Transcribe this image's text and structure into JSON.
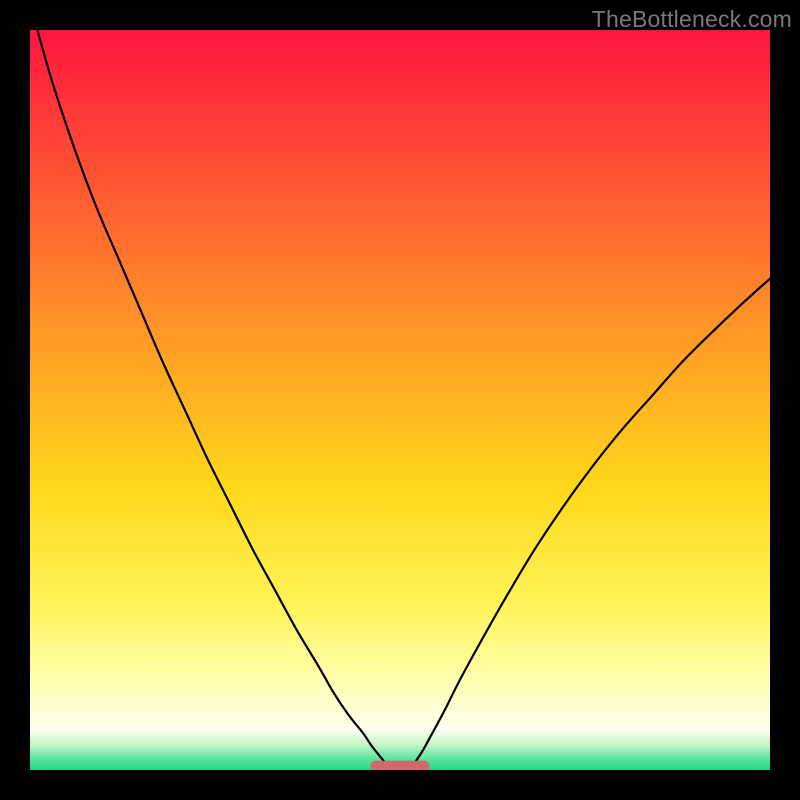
{
  "watermark": "TheBottleneck.com",
  "chart_data": {
    "type": "line",
    "title": "",
    "xlabel": "",
    "ylabel": "",
    "xlim": [
      0,
      100
    ],
    "ylim": [
      0,
      100
    ],
    "grid": false,
    "legend": false,
    "background_gradient": {
      "stops": [
        {
          "pos": 0.0,
          "color": "#ff163f"
        },
        {
          "pos": 0.12,
          "color": "#ff3b37"
        },
        {
          "pos": 0.28,
          "color": "#ff6d2f"
        },
        {
          "pos": 0.45,
          "color": "#ffa524"
        },
        {
          "pos": 0.62,
          "color": "#ffd81a"
        },
        {
          "pos": 0.78,
          "color": "#fff45b"
        },
        {
          "pos": 0.88,
          "color": "#ffffb0"
        },
        {
          "pos": 0.945,
          "color": "#fefef0"
        },
        {
          "pos": 0.965,
          "color": "#c8f7c8"
        },
        {
          "pos": 0.985,
          "color": "#5be29e"
        },
        {
          "pos": 1.0,
          "color": "#1fd882"
        }
      ]
    },
    "series": [
      {
        "name": "left-curve",
        "stroke": "#000000",
        "x": [
          1,
          3,
          6,
          9,
          12,
          15,
          18,
          21,
          24,
          27,
          30,
          33,
          36,
          39,
          41,
          43,
          45,
          46,
          47,
          48
        ],
        "y": [
          100,
          93,
          84,
          76,
          69,
          62,
          55,
          48.5,
          42,
          36,
          30,
          24.5,
          19,
          14,
          10.5,
          7.5,
          5,
          3.5,
          2.2,
          1
        ]
      },
      {
        "name": "right-curve",
        "stroke": "#000000",
        "x": [
          52,
          53,
          54,
          56,
          58,
          61,
          64,
          68,
          72,
          76,
          80,
          84,
          88,
          92,
          96,
          100
        ],
        "y": [
          1,
          2.5,
          4.3,
          8,
          12,
          17.5,
          22.8,
          29.5,
          35.5,
          41,
          46,
          50.5,
          55,
          59,
          62.8,
          66.4
        ]
      }
    ],
    "marker": {
      "name": "bottom-bar",
      "shape": "rounded-rect",
      "color": "#cf6a6a",
      "x_range": [
        46,
        54
      ],
      "y": 0.5,
      "height": 1.5
    }
  }
}
